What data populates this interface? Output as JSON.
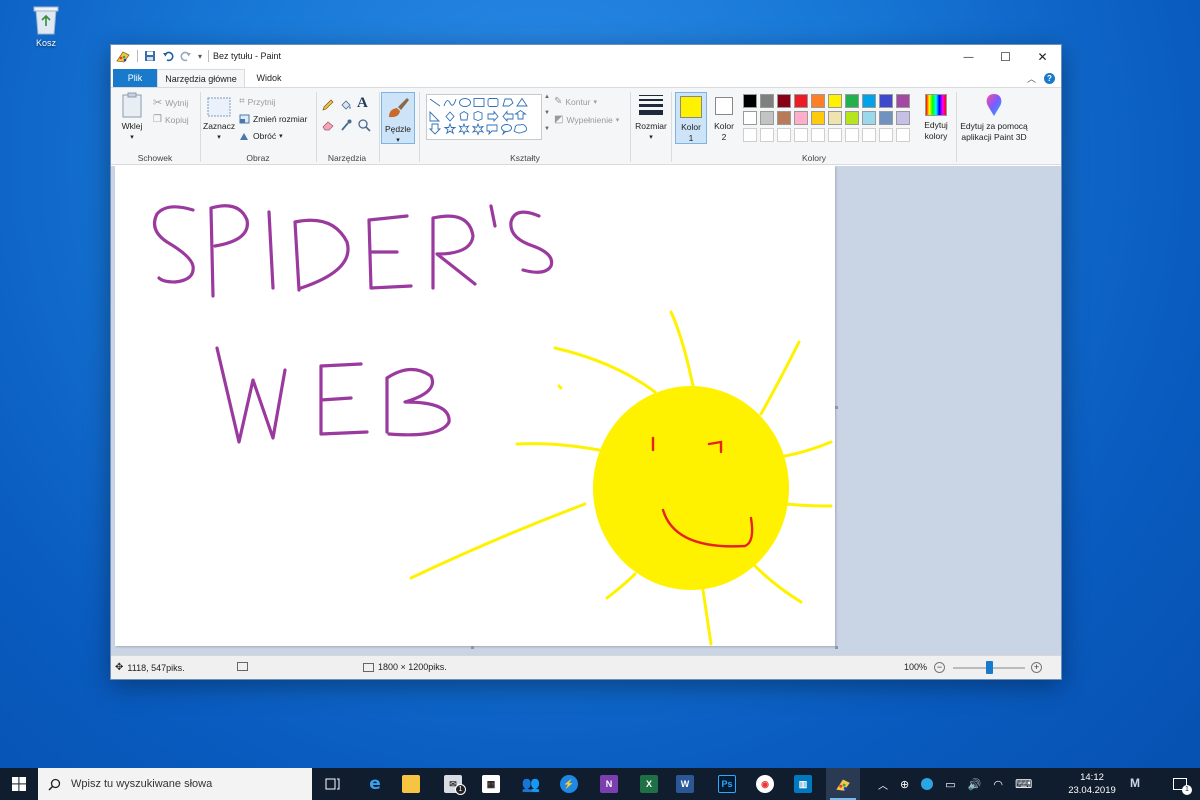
{
  "desktop": {
    "recycle_bin_label": "Kosz"
  },
  "window": {
    "title": "Bez tytułu - Paint",
    "controls": {
      "minimize": "—",
      "maximize": "☐",
      "close": "✕"
    }
  },
  "tabs": {
    "file": "Plik",
    "home": "Narzędzia główne",
    "view": "Widok"
  },
  "ribbon": {
    "clipboard": {
      "paste": "Wklej",
      "cut": "Wytnij",
      "copy": "Kopiuj",
      "group": "Schowek"
    },
    "image": {
      "select": "Zaznacz",
      "crop": "Przytnij",
      "resize": "Zmień rozmiar",
      "rotate": "Obróć",
      "group": "Obraz"
    },
    "tools": {
      "group": "Narzędzia"
    },
    "brushes": {
      "label": "Pędzle"
    },
    "shapes": {
      "outline": "Kontur",
      "fill": "Wypełnienie",
      "group": "Kształty"
    },
    "size": {
      "label": "Rozmiar"
    },
    "colors": {
      "color1": "Kolor",
      "color1_num": "1",
      "color2": "Kolor",
      "color2_num": "2",
      "edit_colors_1": "Edytuj",
      "edit_colors_2": "kolory",
      "group": "Kolory",
      "color1_value": "#fff200",
      "color2_value": "#ffffff",
      "palette_row1": [
        "#000000",
        "#7f7f7f",
        "#880015",
        "#ed1c24",
        "#ff7f27",
        "#fff200",
        "#22b14c",
        "#00a2e8",
        "#3f48cc",
        "#a349a4"
      ],
      "palette_row2": [
        "#ffffff",
        "#c3c3c3",
        "#b97a57",
        "#ffaec9",
        "#ffc90e",
        "#efe4b0",
        "#b5e61d",
        "#99d9ea",
        "#7092be",
        "#c8bfe7"
      ]
    },
    "paint3d": {
      "line1": "Edytuj za pomocą",
      "line2": "aplikacji Paint 3D"
    }
  },
  "drawing": {
    "ink_color": "#9b3a9e",
    "sun_color": "#fff200",
    "face_color": "#e8231f"
  },
  "status": {
    "cursor_pos": "1118, 547piks.",
    "image_size": "1800 × 1200piks.",
    "zoom": "100%",
    "zoom_fraction": 0.5
  },
  "taskbar": {
    "search_placeholder": "Wpisz tu wyszukiwane słowa",
    "mail_badge": "1",
    "time": "14:12",
    "date": "23.04.2019",
    "notification_count": "1"
  }
}
